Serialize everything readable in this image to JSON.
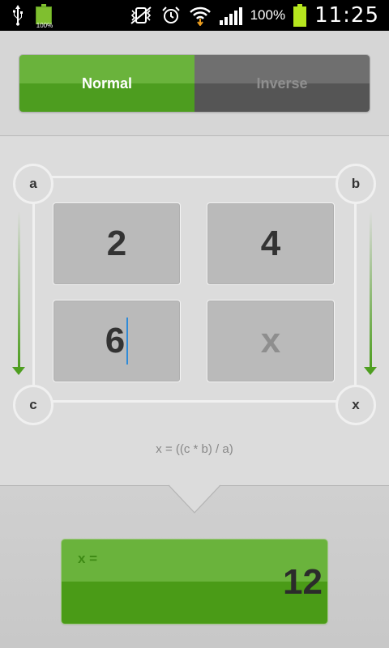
{
  "status_bar": {
    "battery_small_label": "100%",
    "battery_percent": "100%",
    "time": "11:25",
    "icons": [
      "usb-icon",
      "battery-icon",
      "vibrate-icon",
      "alarm-icon",
      "wifi-icon",
      "signal-icon",
      "battery-full-icon"
    ]
  },
  "mode_toggle": {
    "normal_label": "Normal",
    "inverse_label": "Inverse",
    "selected": "Normal"
  },
  "proportion": {
    "corner_a": "a",
    "corner_b": "b",
    "corner_c": "c",
    "corner_x": "x",
    "a_value": "2",
    "b_value": "4",
    "c_value": "6",
    "x_placeholder": "x",
    "formula": "x = ((c * b) / a)"
  },
  "result": {
    "label": "x =",
    "value": "12"
  },
  "colors": {
    "accent_green": "#4e9e20",
    "cursor_blue": "#2f8bd8"
  }
}
